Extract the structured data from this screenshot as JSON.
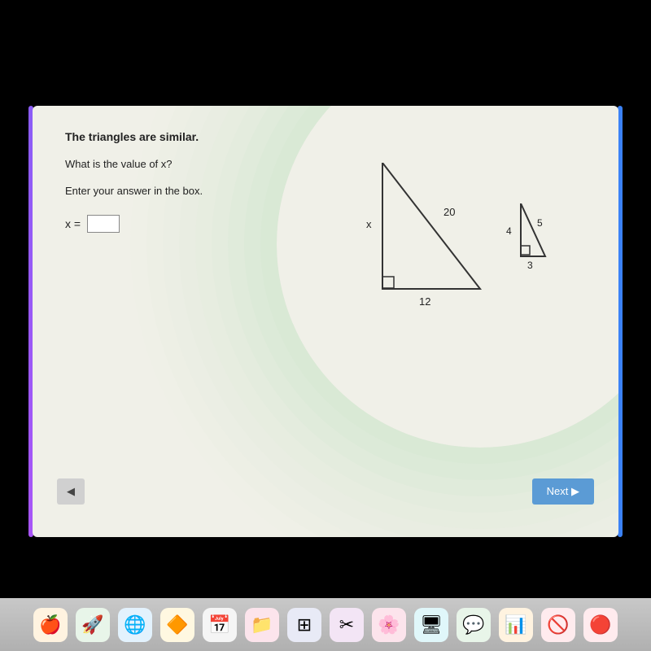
{
  "screen": {
    "title": "The triangles are similar.",
    "question": "What is the value of x?",
    "instruction": "Enter your answer in the box.",
    "answer_label": "x =",
    "answer_value": ""
  },
  "large_triangle": {
    "side_hyp": "20",
    "side_leg": "x",
    "side_base": "12"
  },
  "small_triangle": {
    "side_hyp": "5",
    "side_leg": "4",
    "side_base": "3"
  },
  "buttons": {
    "next_label": "Next ▶",
    "back_label": "◀"
  },
  "taskbar": {
    "icons": [
      "🍎",
      "🚀",
      "🌐",
      "🔶",
      "📅",
      "📁",
      "⊞",
      "✂",
      "🌸",
      "🖥",
      "💬",
      "📊",
      "🚫",
      "🔴"
    ]
  }
}
